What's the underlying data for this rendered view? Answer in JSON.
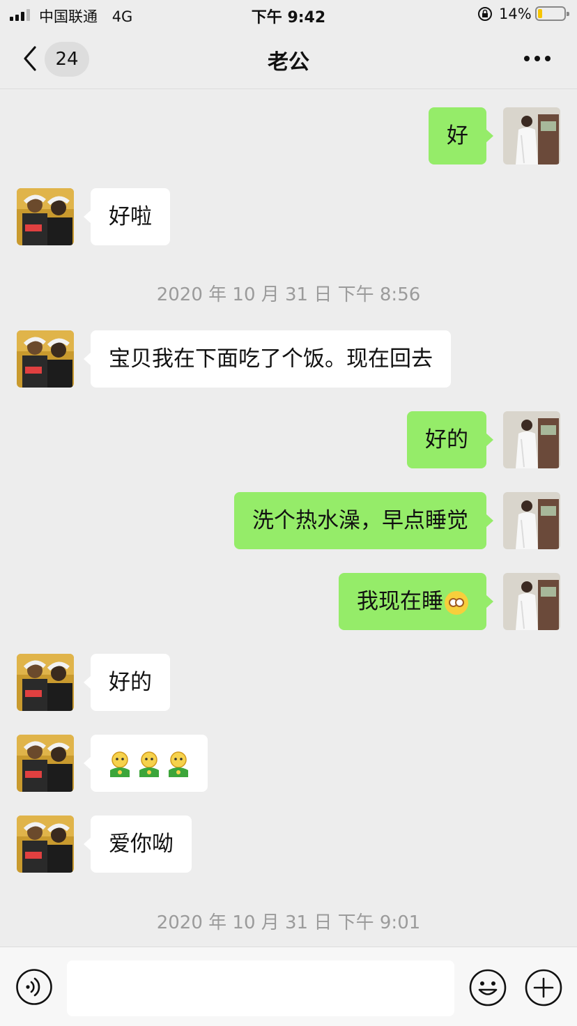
{
  "status_bar": {
    "carrier": "中国联通",
    "network": "4G",
    "time": "下午 9:42",
    "battery_percent": "14%"
  },
  "header": {
    "unread_count": "24",
    "title": "老公"
  },
  "messages": [
    {
      "direction": "outgoing",
      "text": "好"
    },
    {
      "direction": "incoming",
      "text": "好啦"
    },
    {
      "timestamp": "2020 年 10 月 31 日 下午 8:56"
    },
    {
      "direction": "incoming",
      "text": "宝贝我在下面吃了个饭。现在回去"
    },
    {
      "direction": "outgoing",
      "text": "好的"
    },
    {
      "direction": "outgoing",
      "text": "洗个热水澡，早点睡觉"
    },
    {
      "direction": "outgoing",
      "text": "我现在睡",
      "emoji": "flushed-face"
    },
    {
      "direction": "incoming",
      "text": "好的"
    },
    {
      "direction": "incoming",
      "sticker": "green-person-sticker",
      "count": 3
    },
    {
      "direction": "incoming",
      "text": "爱你呦"
    },
    {
      "timestamp": "2020 年 10 月 31 日 下午 9:01"
    }
  ],
  "input_bar": {
    "placeholder": ""
  },
  "colors": {
    "background": "#ededed",
    "outgoing_bubble": "#95ec69",
    "incoming_bubble": "#ffffff",
    "timestamp_text": "#9b9b9b",
    "battery_low": "#f7c500"
  }
}
